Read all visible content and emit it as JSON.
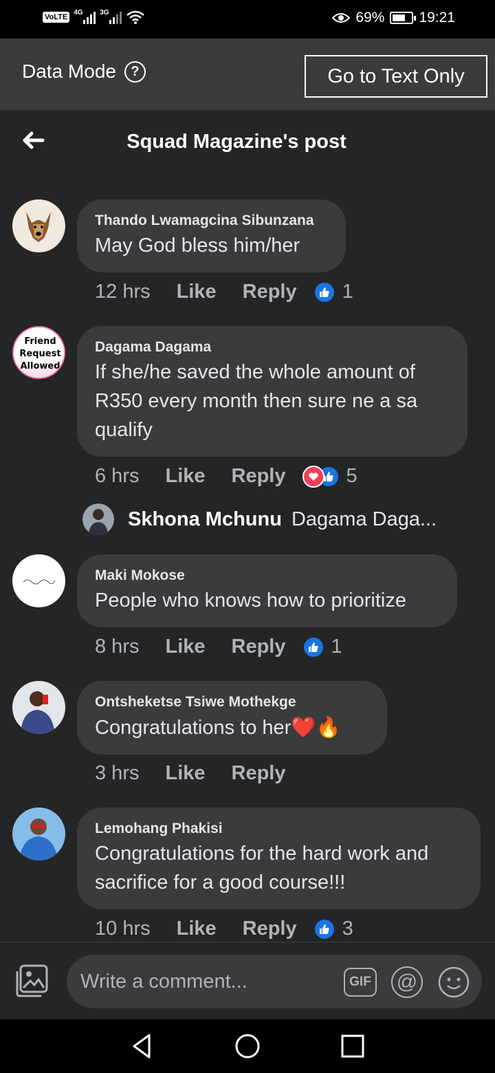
{
  "status_bar": {
    "volte": "VoLTE",
    "signal1_gen": "4G",
    "signal2_gen": "3G",
    "battery_percent": "69%",
    "battery_level": 0.69,
    "time": "19:21"
  },
  "data_mode": {
    "label": "Data Mode",
    "help_glyph": "?",
    "text_only_button": "Go to Text Only"
  },
  "header": {
    "title": "Squad Magazine's post"
  },
  "comments": [
    {
      "author": "Thando Lwamagcina Sibunzana",
      "text": "May God bless him/her",
      "time": "12 hrs",
      "like": "Like",
      "reply": "Reply",
      "reaction_count": "1"
    },
    {
      "author": "Dagama Dagama",
      "text": "If she/he saved the whole amount of R350 every month then sure ne a sa qualify",
      "time": "6 hrs",
      "like": "Like",
      "reply": "Reply",
      "reaction_count": "5",
      "avatar_text": [
        "Friend",
        "Request",
        "Allowed"
      ]
    },
    {
      "author": "Maki Mokose",
      "text": "People who knows how to prioritize",
      "time": "8 hrs",
      "like": "Like",
      "reply": "Reply",
      "reaction_count": "1"
    },
    {
      "author": "Ontsheketse Tsiwe Mothekge",
      "text": "Congratulations to her",
      "emoji": "❤️🔥",
      "time": "3 hrs",
      "like": "Like",
      "reply": "Reply"
    },
    {
      "author": "Lemohang Phakisi",
      "text": "Congratulations for the hard work and sacrifice for a good course!!!",
      "time": "10 hrs",
      "like": "Like",
      "reply": "Reply",
      "reaction_count": "3"
    }
  ],
  "reply_preview": {
    "name": "Skhona Mchunu",
    "text": "Dagama Daga..."
  },
  "composer": {
    "placeholder": "Write a comment...",
    "gif_label": "GIF",
    "at_label": "@"
  },
  "colors": {
    "background": "#242526",
    "bubble": "#3a3b3c",
    "like_blue": "#1b74e4",
    "love_red": "#f33e58",
    "secondary_text": "#b0b3b8"
  }
}
